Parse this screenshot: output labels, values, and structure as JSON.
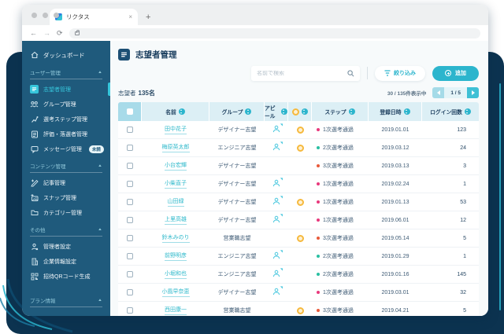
{
  "colors": {
    "accent": "#2cb5cd",
    "sidebar_bg": "#1f5a7c",
    "active_cyan": "#36c6db",
    "backdrop_navy": "#0c3350",
    "step_first": "#e8397c",
    "step_second": "#2abfa2",
    "step_third": "#e85a3a"
  },
  "browser": {
    "tab_title": "リクタス",
    "tab_close": "×",
    "new_tab": "+",
    "back": "←",
    "forward": "→",
    "reload": "⟳"
  },
  "sidebar": {
    "dashboard": "ダッシュボード",
    "sections": {
      "user": {
        "label": "ユーザー管理",
        "items": {
          "applicants": "志望者管理",
          "groups": "グループ管理",
          "steps": "選考ステップ管理",
          "evaluation": "評価・落選者管理",
          "messages": "メッセージ管理",
          "messages_badge": "未読"
        }
      },
      "content": {
        "label": "コンテンツ管理",
        "items": {
          "articles": "記事管理",
          "snaps": "スナップ管理",
          "categories": "カテゴリー管理"
        }
      },
      "other": {
        "label": "その他",
        "items": {
          "admin": "管理者設定",
          "company": "企業情報設定",
          "qr": "招待QRコード生成"
        }
      },
      "plan": {
        "label": "プラン情報"
      }
    }
  },
  "header": {
    "title": "志望者管理"
  },
  "toolbar": {
    "search_placeholder": "名前で検索",
    "filter_label": "絞り込み",
    "add_label": "追加"
  },
  "summary": {
    "applicants_label": "志望者",
    "applicants_count": "135名",
    "showing": "30 / 135件表示中",
    "page": "1 / 5"
  },
  "table": {
    "columns": {
      "name": "名前",
      "group": "グループ",
      "appeal": "アピール",
      "step": "ステップ",
      "registered": "登録日時",
      "logins": "ログイン回数"
    },
    "rows": [
      {
        "name": "田中花子",
        "group": "デザイナー志望",
        "appeal": true,
        "pickup": true,
        "step": "1次選考通過",
        "step_color": "#e8397c",
        "date": "2019.01.01",
        "logins": "123"
      },
      {
        "name": "梅原英太郎",
        "group": "エンジニア志望",
        "appeal": true,
        "pickup": true,
        "step": "2次選考通過",
        "step_color": "#2abfa2",
        "date": "2019.03.12",
        "logins": "24"
      },
      {
        "name": "小台宏輝",
        "group": "デザイナー志望",
        "appeal": false,
        "pickup": false,
        "step": "3次選考通過",
        "step_color": "#e85a3a",
        "date": "2019.03.13",
        "logins": "3"
      },
      {
        "name": "小柴直子",
        "group": "デザイナー志望",
        "appeal": true,
        "pickup": false,
        "step": "1次選考通過",
        "step_color": "#e8397c",
        "date": "2019.02.24",
        "logins": "1"
      },
      {
        "name": "山田緑",
        "group": "デザイナー志望",
        "appeal": true,
        "pickup": true,
        "step": "1次選考通過",
        "step_color": "#e8397c",
        "date": "2019.01.13",
        "logins": "53"
      },
      {
        "name": "上里高雄",
        "group": "デザイナー志望",
        "appeal": true,
        "pickup": false,
        "step": "1次選考通過",
        "step_color": "#e8397c",
        "date": "2019.06.01",
        "logins": "12"
      },
      {
        "name": "鈴木みのり",
        "group": "営業職志望",
        "appeal": false,
        "pickup": true,
        "step": "3次選考通過",
        "step_color": "#e85a3a",
        "date": "2019.05.14",
        "logins": "5"
      },
      {
        "name": "前野明彦",
        "group": "エンジニア志望",
        "appeal": true,
        "pickup": false,
        "step": "2次選考通過",
        "step_color": "#2abfa2",
        "date": "2019.01.29",
        "logins": "1"
      },
      {
        "name": "小堀和也",
        "group": "エンジニア志望",
        "appeal": true,
        "pickup": false,
        "step": "2次選考通過",
        "step_color": "#2abfa2",
        "date": "2019.01.16",
        "logins": "145"
      },
      {
        "name": "小風早奈恵",
        "group": "デザイナー志望",
        "appeal": true,
        "pickup": false,
        "step": "1次選考通過",
        "step_color": "#e8397c",
        "date": "2019.03.01",
        "logins": "32"
      },
      {
        "name": "西田康一",
        "group": "営業職志望",
        "appeal": false,
        "pickup": true,
        "step": "3次選考通過",
        "step_color": "#e85a3a",
        "date": "2019.04.21",
        "logins": "5"
      }
    ]
  }
}
